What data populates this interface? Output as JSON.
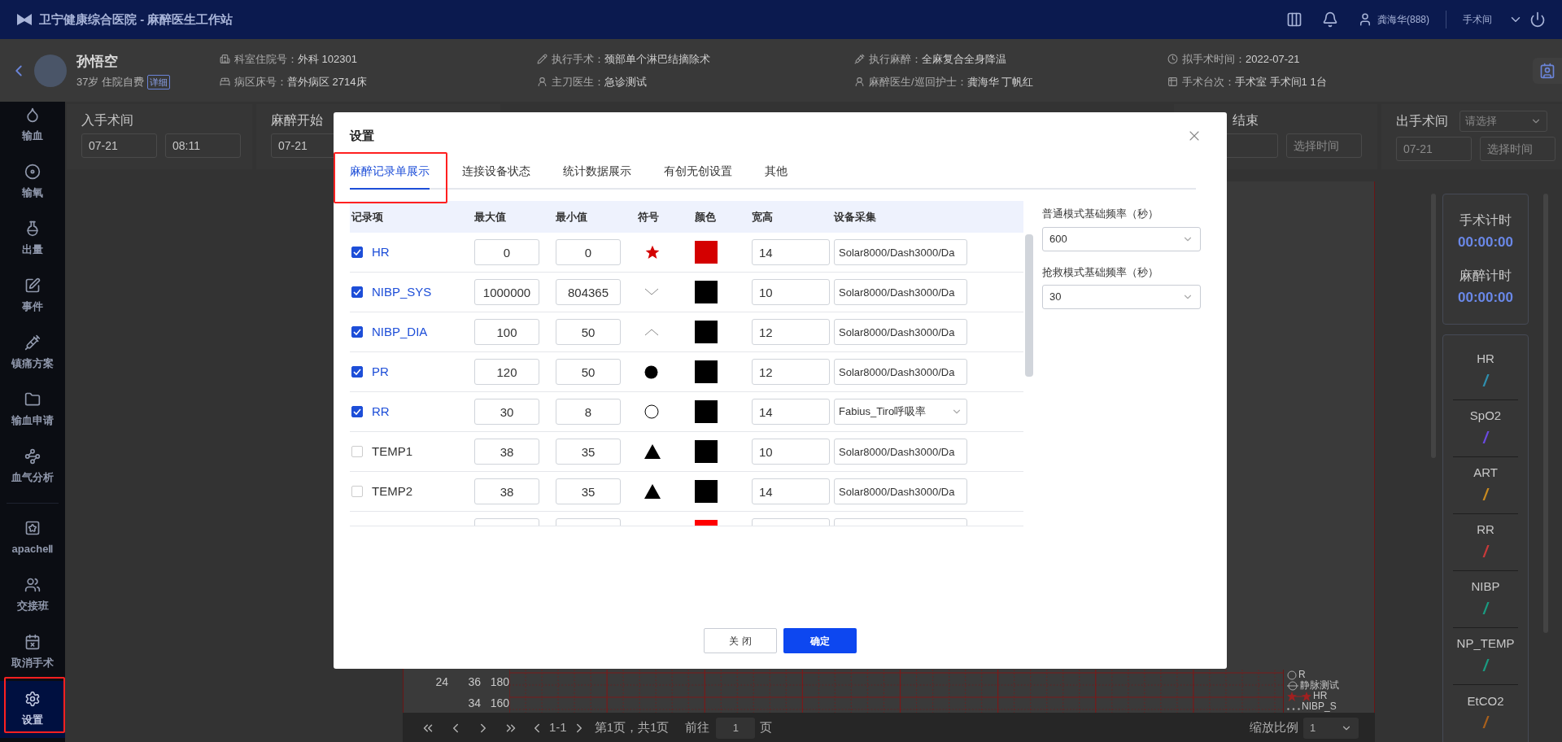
{
  "header": {
    "title": "卫宁健康综合医院 - 麻醉医生工作站",
    "user": "龚海华(888)",
    "room": "手术间"
  },
  "patient": {
    "name": "孙悟空",
    "info": "37岁 住院自费",
    "badge": "详细",
    "fields": [
      {
        "label": "科室住院号：",
        "value": "外科 102301"
      },
      {
        "label": "执行手术：",
        "value": "颈部单个淋巴结摘除术"
      },
      {
        "label": "执行麻醉：",
        "value": "全麻复合全身降温"
      },
      {
        "label": "拟手术时间：",
        "value": "2022-07-21"
      },
      {
        "label": "病区床号：",
        "value": "普外病区 2714床"
      },
      {
        "label": "主刀医生：",
        "value": "急诊测试"
      },
      {
        "label": "麻醉医生/巡回护士：",
        "value": "龚海华 丁帆红"
      },
      {
        "label": "手术台次：",
        "value": "手术室 手术间1 1台"
      }
    ]
  },
  "sidebar": [
    {
      "label": "输血",
      "selected": false
    },
    {
      "label": "输氧",
      "selected": false
    },
    {
      "label": "出量",
      "selected": false
    },
    {
      "label": "事件",
      "selected": false
    },
    {
      "label": "镇痛方案",
      "selected": false
    },
    {
      "label": "输血申请",
      "selected": false
    },
    {
      "label": "血气分析",
      "selected": false
    },
    {
      "label": "apacheⅡ",
      "selected": false
    },
    {
      "label": "交接班",
      "selected": false
    },
    {
      "label": "取消手术",
      "selected": false
    },
    {
      "label": "设置",
      "selected": true
    }
  ],
  "time_cards": [
    {
      "label": "入手术间",
      "fields": [
        {
          "value": "07-21"
        },
        {
          "value": "08:11"
        }
      ]
    },
    {
      "label": "麻醉开始",
      "fields": [
        {
          "value": "07-21"
        }
      ]
    },
    {
      "label": "结束",
      "fields": [
        {
          "kind": "blank"
        },
        {
          "placeholder": "选择时间"
        }
      ]
    },
    {
      "label": "出手术间",
      "select": {
        "placeholder": "请选择"
      },
      "fields": [
        {
          "placeholder": "07-21"
        },
        {
          "placeholder": "选择时间"
        }
      ]
    }
  ],
  "record_sheet": {
    "axis_rows": [
      [
        "24",
        "36",
        "180"
      ],
      [
        "",
        "34",
        "160"
      ]
    ],
    "legend": [
      {
        "label": "R",
        "kind": "letter"
      },
      {
        "label": "静脉测试",
        "kind": "line"
      },
      {
        "label": "HR",
        "kind": "stars"
      },
      {
        "label": "NIBP_S",
        "kind": "dots"
      }
    ]
  },
  "pagination": {
    "range": "1-1",
    "summary": "第1页，共1页",
    "goto_label": "前往",
    "page": "1",
    "page_unit": "页",
    "zoom_label": "缩放比例",
    "zoom": "1"
  },
  "timers": [
    {
      "label": "手术计时",
      "value": "00:00:00"
    },
    {
      "label": "麻醉计时",
      "value": "00:00:00"
    }
  ],
  "vitals": [
    {
      "name": "HR",
      "value": "/",
      "color": "#2f8fae"
    },
    {
      "name": "SpO2",
      "value": "/",
      "color": "#6a4ae0"
    },
    {
      "name": "ART",
      "value": "/",
      "color": "#c88a20"
    },
    {
      "name": "RR",
      "value": "/",
      "color": "#c83a3a"
    },
    {
      "name": "NIBP",
      "value": "/",
      "color": "#1a9a80"
    },
    {
      "name": "NP_TEMP",
      "value": "/",
      "color": "#1a9a80"
    },
    {
      "name": "EtCO2",
      "value": "/",
      "color": "#a8601c"
    }
  ],
  "dialog": {
    "title": "设置",
    "tabs": [
      {
        "label": "麻醉记录单展示",
        "selected": true
      },
      {
        "label": "连接设备状态",
        "selected": false
      },
      {
        "label": "统计数据展示",
        "selected": false
      },
      {
        "label": "有创无创设置",
        "selected": false
      },
      {
        "label": "其他",
        "selected": false
      }
    ],
    "columns": [
      "记录项",
      "最大值",
      "最小值",
      "符号",
      "颜色",
      "宽高",
      "设备采集"
    ],
    "rows": [
      {
        "kind": "row",
        "checked": true,
        "name": "HR",
        "max": "0",
        "min": "0",
        "symbol": {
          "kind": "star"
        },
        "color": "#d40000",
        "size": "14",
        "device": "Solar8000/Dash3000/Da",
        "device_dropdown": false
      },
      {
        "kind": "row",
        "checked": true,
        "name": "NIBP_SYS",
        "max": "1000000",
        "min": "804365",
        "symbol": {
          "kind": "down"
        },
        "color": "#000000",
        "size": "10",
        "device": "Solar8000/Dash3000/Da",
        "device_dropdown": false
      },
      {
        "kind": "row",
        "checked": true,
        "name": "NIBP_DIA",
        "max": "100",
        "min": "50",
        "symbol": {
          "kind": "up"
        },
        "color": "#000000",
        "size": "12",
        "device": "Solar8000/Dash3000/Da",
        "device_dropdown": false
      },
      {
        "kind": "row",
        "checked": true,
        "name": "PR",
        "max": "120",
        "min": "50",
        "symbol": {
          "kind": "dot"
        },
        "color": "#000000",
        "size": "12",
        "device": "Solar8000/Dash3000/Da",
        "device_dropdown": false
      },
      {
        "kind": "row",
        "checked": true,
        "name": "RR",
        "max": "30",
        "min": "8",
        "symbol": {
          "kind": "ring"
        },
        "color": "#000000",
        "size": "14",
        "device": "Fabius_Tiro呼吸率",
        "device_dropdown": true
      },
      {
        "kind": "row",
        "checked": false,
        "name": "TEMP1",
        "max": "38",
        "min": "35",
        "symbol": {
          "kind": "triangle"
        },
        "color": "#000000",
        "size": "10",
        "device": "Solar8000/Dash3000/Da",
        "device_dropdown": false
      },
      {
        "kind": "row",
        "checked": false,
        "name": "TEMP2",
        "max": "38",
        "min": "35",
        "symbol": {
          "kind": "triangle"
        },
        "color": "#000000",
        "size": "14",
        "device": "Solar8000/Dash3000/Da",
        "device_dropdown": false
      },
      {
        "kind": "clipped",
        "color": "#ff0000"
      }
    ],
    "settings": [
      {
        "label": "普通模式基础频率（秒）",
        "value": "600"
      },
      {
        "label": "抢救模式基础频率（秒）",
        "value": "30"
      }
    ],
    "buttons": [
      {
        "label": "关 闭",
        "kind": "secondary"
      },
      {
        "label": "确定",
        "kind": "primary"
      }
    ]
  }
}
